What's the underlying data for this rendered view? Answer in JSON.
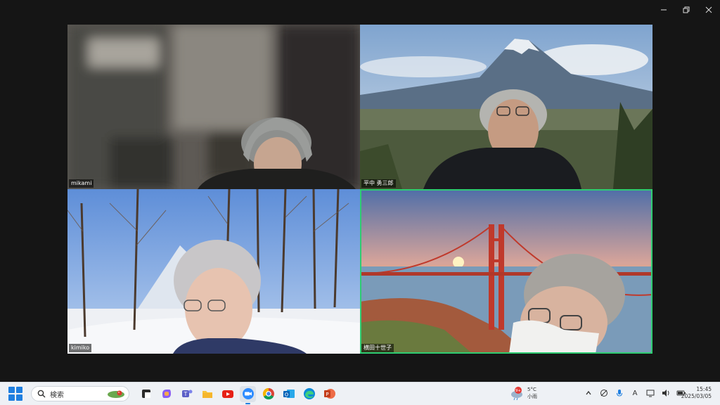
{
  "window": {
    "controls": [
      "minimize-icon",
      "restore-icon",
      "close-icon"
    ]
  },
  "gallery": {
    "tiles": [
      {
        "name": "mikami"
      },
      {
        "name": "平中 勇三郎"
      },
      {
        "name": "kimiko"
      },
      {
        "name": "横田十世子",
        "active": true
      }
    ],
    "active_color": "#2ecc71"
  },
  "taskbar": {
    "search_placeholder": "検索",
    "apps": [
      "file-icon",
      "copilot-icon",
      "teams-icon",
      "file-explorer-icon",
      "youtube-icon",
      "zoom-icon",
      "chrome-icon",
      "outlook-icon",
      "edge-icon",
      "powerpoint-icon"
    ],
    "weather": {
      "temp": "5°C",
      "condition": "小雨",
      "badge": "9+"
    },
    "tray_icons": [
      "chevron-up-icon",
      "network-icon",
      "microphone-icon",
      "input-method-icon",
      "display-icon",
      "speaker-icon",
      "battery-icon"
    ],
    "ime_label": "A",
    "clock": {
      "time": "15:45",
      "date": "2025/03/05"
    }
  }
}
